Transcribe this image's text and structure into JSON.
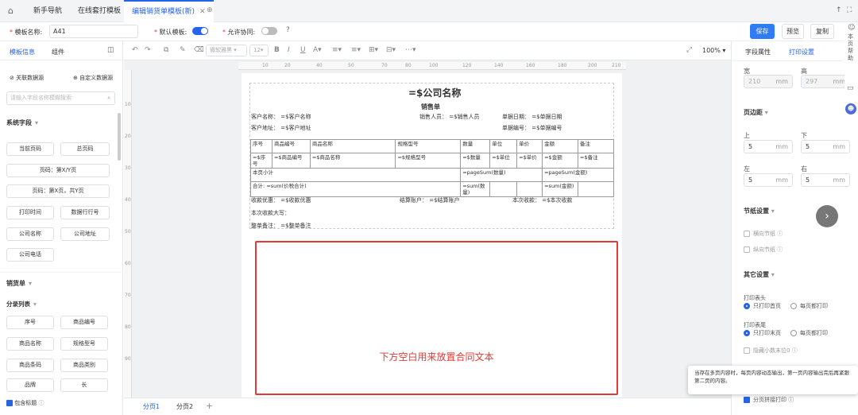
{
  "tabs": [
    {
      "label": "新手导航"
    },
    {
      "label": "在线套打模板"
    },
    {
      "label": "编辑销货单模板(新)"
    }
  ],
  "form": {
    "template_name_label": "模板名称:",
    "template_name_value": "A41",
    "default_template_label": "默认模板:",
    "allow_collab_label": "允许协同:",
    "save": "保存",
    "preview": "预览",
    "copy": "复制"
  },
  "left": {
    "tab1": "模板信息",
    "tab2": "组件",
    "link_source": "关联数据源",
    "custom_source": "自定义数据源",
    "search_placeholder": "请输入字段名称模糊搜索",
    "system_fields": "系统字段",
    "system_buttons": [
      "当前页码",
      "总页码",
      "页码：第X/Y页",
      "页码：第X页，共Y页",
      "打印时间",
      "数据行行号",
      "公司名称",
      "公司地址",
      "公司电话"
    ],
    "sales_section": "销货单",
    "list_section": "分录列表",
    "list_buttons": [
      "序号",
      "商品编号",
      "商品名称",
      "规格型号",
      "商品条码",
      "商品类别",
      "品牌",
      "长"
    ],
    "include_header": "包含标题"
  },
  "toolbar": {
    "font_placeholder": "微软雅黑",
    "font_size": "12",
    "zoom": "100%"
  },
  "paper": {
    "company": "=$公司名称",
    "doc_title": "销售单",
    "customer_name": "客户名称：   =$客户名称",
    "salesperson": "销售人员：   =$销售人员",
    "doc_date": "单据日期：   =$单据日期",
    "customer_addr": "客户地址：   =$客户地址",
    "doc_no": "单据编号：   =$单据编号",
    "table_headers": [
      "序号",
      "商品编号",
      "商品名称",
      "规格型号",
      "数量",
      "单位",
      "单价",
      "金额",
      "备注"
    ],
    "table_row": [
      "=$序号",
      "=$商品编号",
      "=$商品名称",
      "=$规格型号",
      "=$数量",
      "=$单位",
      "=$单价",
      "=$金额",
      "=$备注"
    ],
    "subtotal_label": "本页小计",
    "subtotal_qty": "=pageSum(数量)",
    "subtotal_amt": "=pageSum(金额)",
    "total_label": "合计:   =sum(价税合计)",
    "total_qty": "=sum(数量)",
    "total_amt": "=sum(金额)",
    "discount": "收款优惠：   =$收款优惠",
    "settle": "结算账户：   =$结算账户",
    "received": "本次收款：   =$本次收款",
    "received_caps": "本次收款大写：",
    "remark": "整单备注：   =$整单备注",
    "contract_note": "下方空白用来放置合同文本"
  },
  "pages": [
    "分页1",
    "分页2"
  ],
  "right": {
    "tab1": "字段属性",
    "tab2": "打印设置",
    "width_label": "宽",
    "height_label": "高",
    "width_val": "210",
    "height_val": "297",
    "unit": "mm",
    "margin_section": "页边距",
    "top": "上",
    "bottom": "下",
    "left": "左",
    "right": "右",
    "margin_val": "5",
    "paper_section": "节纸设置",
    "horizontal": "横向节纸",
    "vertical": "纵向节纸",
    "other_section": "其它设置",
    "print_header": "打印表头",
    "first_page_only": "只打印首页",
    "every_page": "每页都打印",
    "print_footer": "打印表尾",
    "last_page_only": "只打印末页",
    "hide_decimal": "隐藏小数末位0",
    "page_join": "分页拼接打印",
    "tooltip": "当存在多页内容时，每页内容动态输出，第一页内容输出完后再紧跟第二页的内容。"
  },
  "side_help": "本页帮助"
}
